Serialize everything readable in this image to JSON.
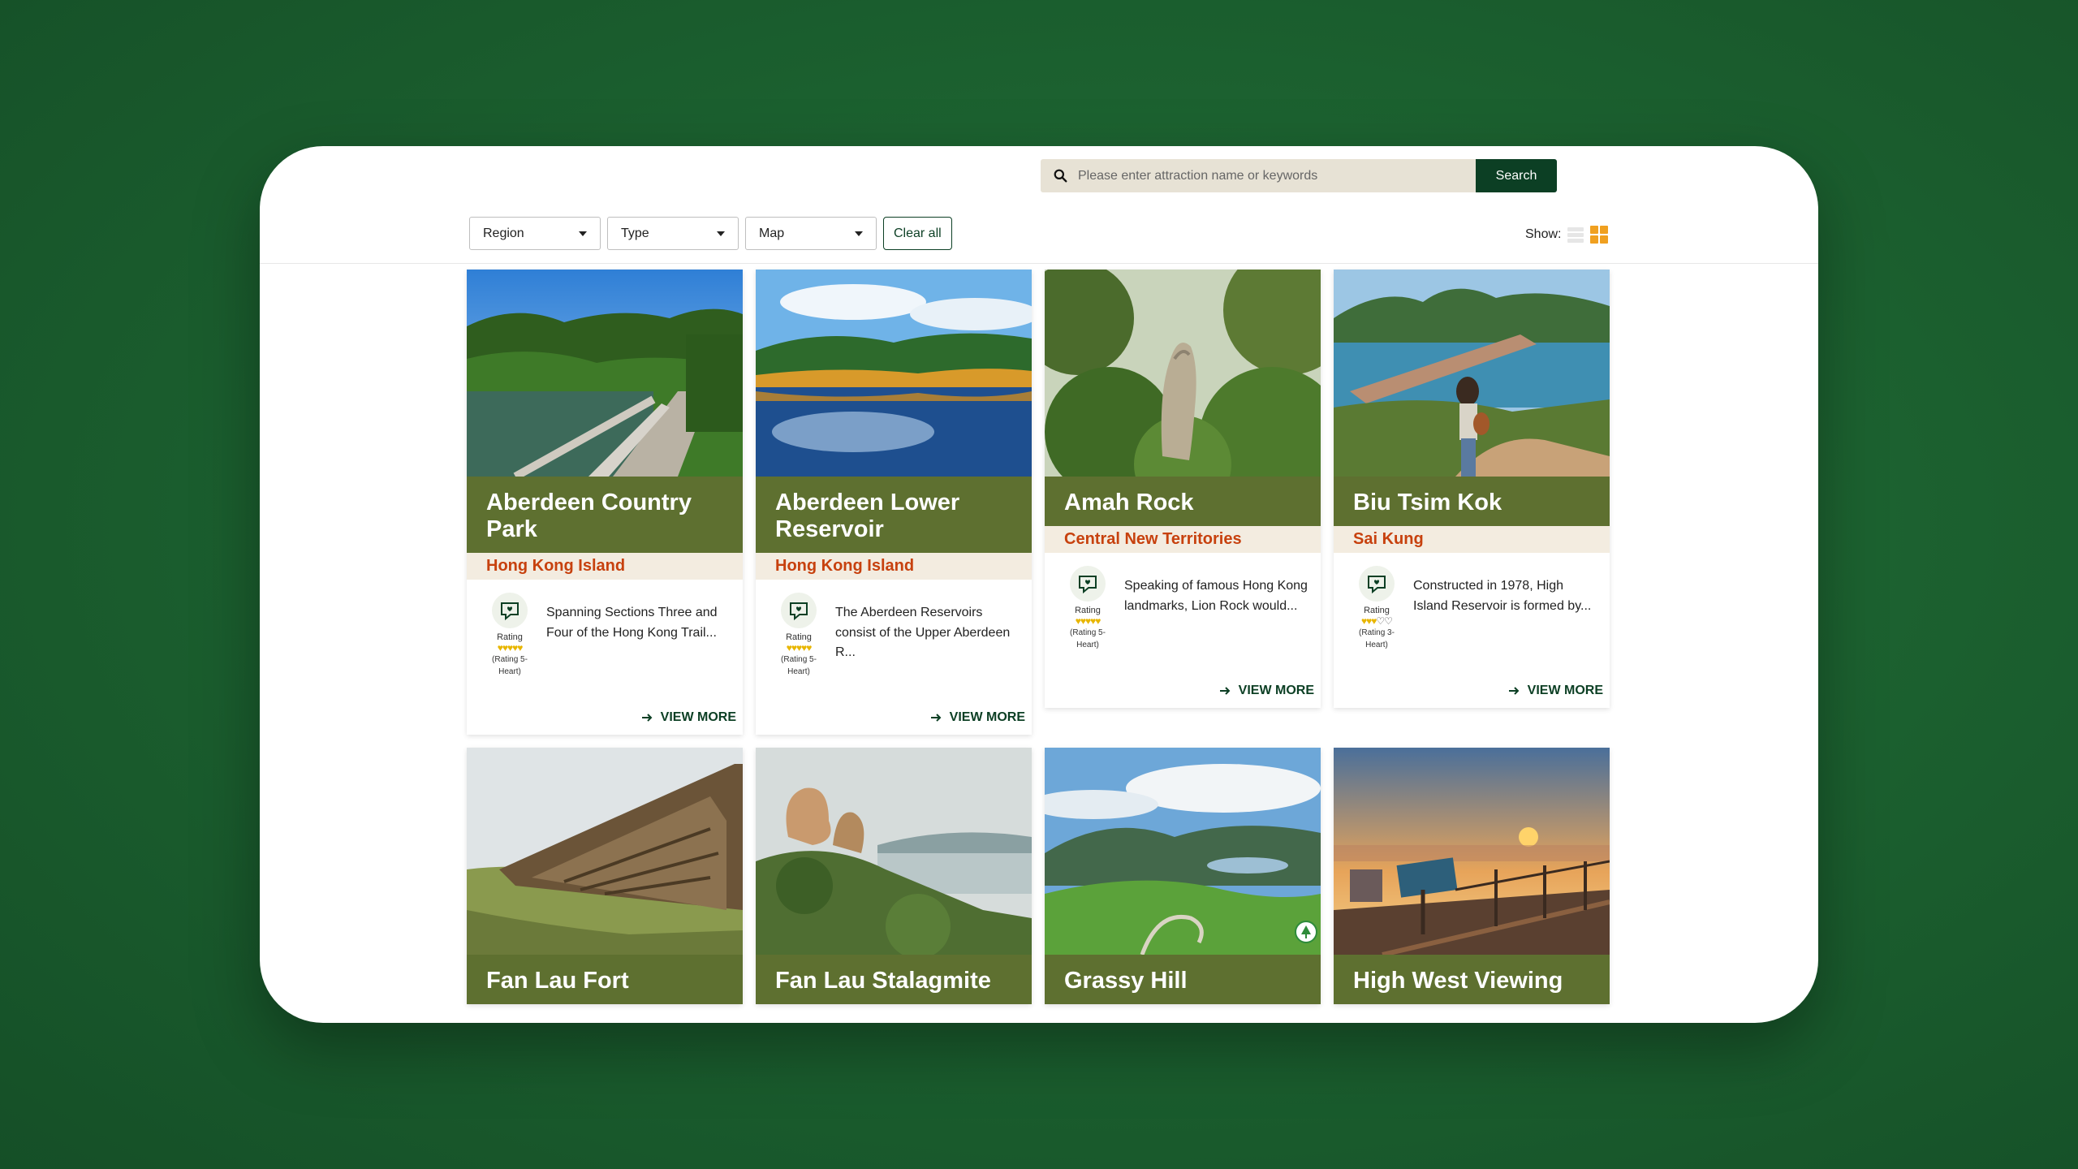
{
  "search": {
    "placeholder": "Please enter attraction name or keywords",
    "button_label": "Search"
  },
  "filters": {
    "region": "Region",
    "type": "Type",
    "map": "Map",
    "clear_all": "Clear all"
  },
  "view": {
    "show_label": "Show:",
    "active_layout": "grid",
    "accent": "#f0a020"
  },
  "colors": {
    "title_bg": "#5e7030",
    "region_text": "#c7410e",
    "region_bg": "#f3ece0",
    "dark_green": "#0c3f24",
    "heart": "#e8b600"
  },
  "cards": [
    {
      "title": "Aberdeen Country Park",
      "region": "Hong Kong Island",
      "rating_label": "Rating",
      "hearts": 5,
      "rating_note": "(Rating 5-Heart)",
      "description": "Spanning Sections Three and Four of the Hong Kong Trail...",
      "view_more": "VIEW MORE"
    },
    {
      "title": "Aberdeen Lower Reservoir",
      "region": "Hong Kong Island",
      "rating_label": "Rating",
      "hearts": 5,
      "rating_note": "(Rating 5-Heart)",
      "description": "The Aberdeen Reservoirs consist of the Upper Aberdeen R...",
      "view_more": "VIEW MORE"
    },
    {
      "title": "Amah Rock",
      "region": "Central New Territories",
      "rating_label": "Rating",
      "hearts": 5,
      "rating_note": "(Rating 5-Heart)",
      "description": "Speaking of famous Hong Kong landmarks, Lion Rock would...",
      "view_more": "VIEW MORE"
    },
    {
      "title": "Biu Tsim Kok",
      "region": "Sai Kung",
      "rating_label": "Rating",
      "hearts": 3,
      "rating_note": "(Rating 3-Heart)",
      "description": "Constructed in 1978, High Island Reservoir is formed by...",
      "view_more": "VIEW MORE"
    },
    {
      "title": "Fan Lau Fort"
    },
    {
      "title": "Fan Lau Stalagmite"
    },
    {
      "title": "Grassy Hill"
    },
    {
      "title": "High West Viewing"
    }
  ]
}
